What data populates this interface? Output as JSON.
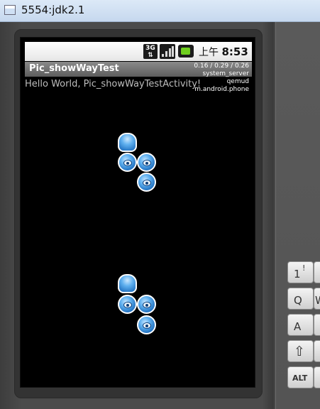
{
  "window": {
    "title": "5554:jdk2.1"
  },
  "statusbar": {
    "network": "3G",
    "time_prefix": "上午",
    "time": "8:53"
  },
  "app": {
    "title": "Pic_showWayTest"
  },
  "load_overlay": [
    "0.16 / 0.29 / 0.26",
    "system_server",
    "qemud",
    "m.android.phone"
  ],
  "content": {
    "hello_text": "Hello World, Pic_showWayTestActivity!"
  },
  "keyboard": {
    "keys": [
      {
        "main": "1",
        "sub": "!"
      },
      {
        "main": "Q",
        "sub": ""
      },
      {
        "main": "A",
        "sub": ""
      },
      {
        "main": "⇧",
        "sub": ""
      },
      {
        "main": "ALT",
        "sub": ""
      }
    ],
    "peek": [
      "",
      "W",
      "",
      "",
      ""
    ]
  }
}
